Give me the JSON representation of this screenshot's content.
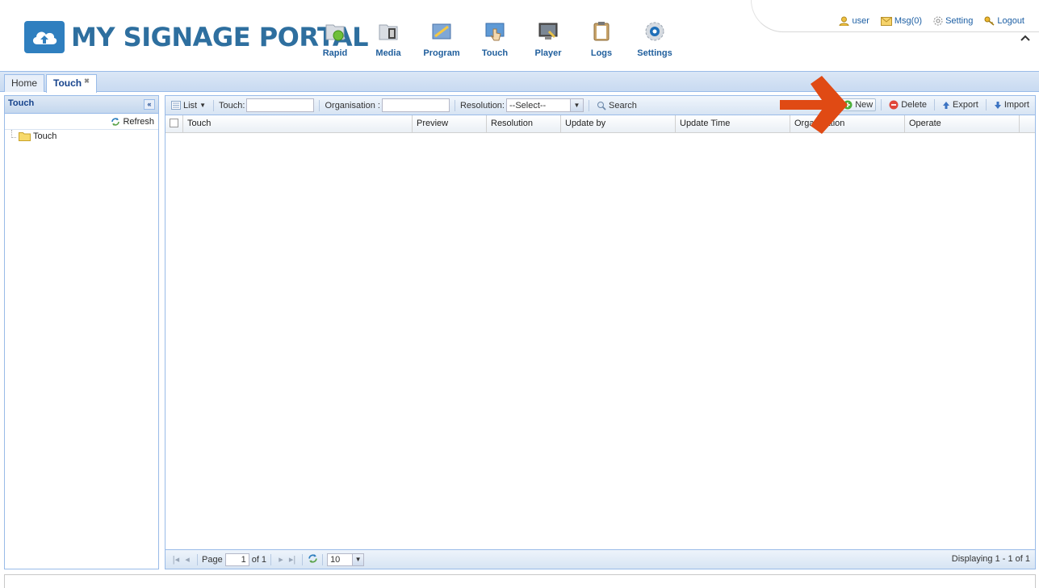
{
  "brand": {
    "name": "MY SIGNAGE PORTAL",
    "color": "#2e6f9f"
  },
  "nav": [
    {
      "label": "Rapid",
      "icon": "rapid-icon"
    },
    {
      "label": "Media",
      "icon": "media-icon"
    },
    {
      "label": "Program",
      "icon": "program-icon"
    },
    {
      "label": "Touch",
      "icon": "touch-icon"
    },
    {
      "label": "Player",
      "icon": "player-icon"
    },
    {
      "label": "Logs",
      "icon": "logs-icon"
    },
    {
      "label": "Settings",
      "icon": "settings-icon"
    }
  ],
  "topright": {
    "user": "user",
    "msg": "Msg(0)",
    "setting": "Setting",
    "logout": "Logout"
  },
  "tabs": [
    {
      "label": "Home",
      "active": false
    },
    {
      "label": "Touch",
      "active": true
    }
  ],
  "left_panel": {
    "title": "Touch",
    "refresh": "Refresh",
    "tree": [
      {
        "label": "Touch"
      }
    ]
  },
  "toolbar": {
    "list": "List",
    "touch_label": "Touch:",
    "touch_value": "",
    "org_label": "Organisation :",
    "org_value": "",
    "res_label": "Resolution:",
    "res_value": "--Select--",
    "search": "Search",
    "new": "New",
    "delete": "Delete",
    "export": "Export",
    "import": "Import"
  },
  "columns": [
    "Touch",
    "Preview",
    "Resolution",
    "Update by",
    "Update Time",
    "Organisation",
    "Operate"
  ],
  "rows": [],
  "pager": {
    "page_label": "Page",
    "page_value": "1",
    "of": "of 1",
    "page_size": "10",
    "displaying": "Displaying 1 - 1 of 1"
  },
  "colors": {
    "accent": "#99bbe8",
    "arrow": "#e04a14",
    "header_text": "#15428b"
  }
}
